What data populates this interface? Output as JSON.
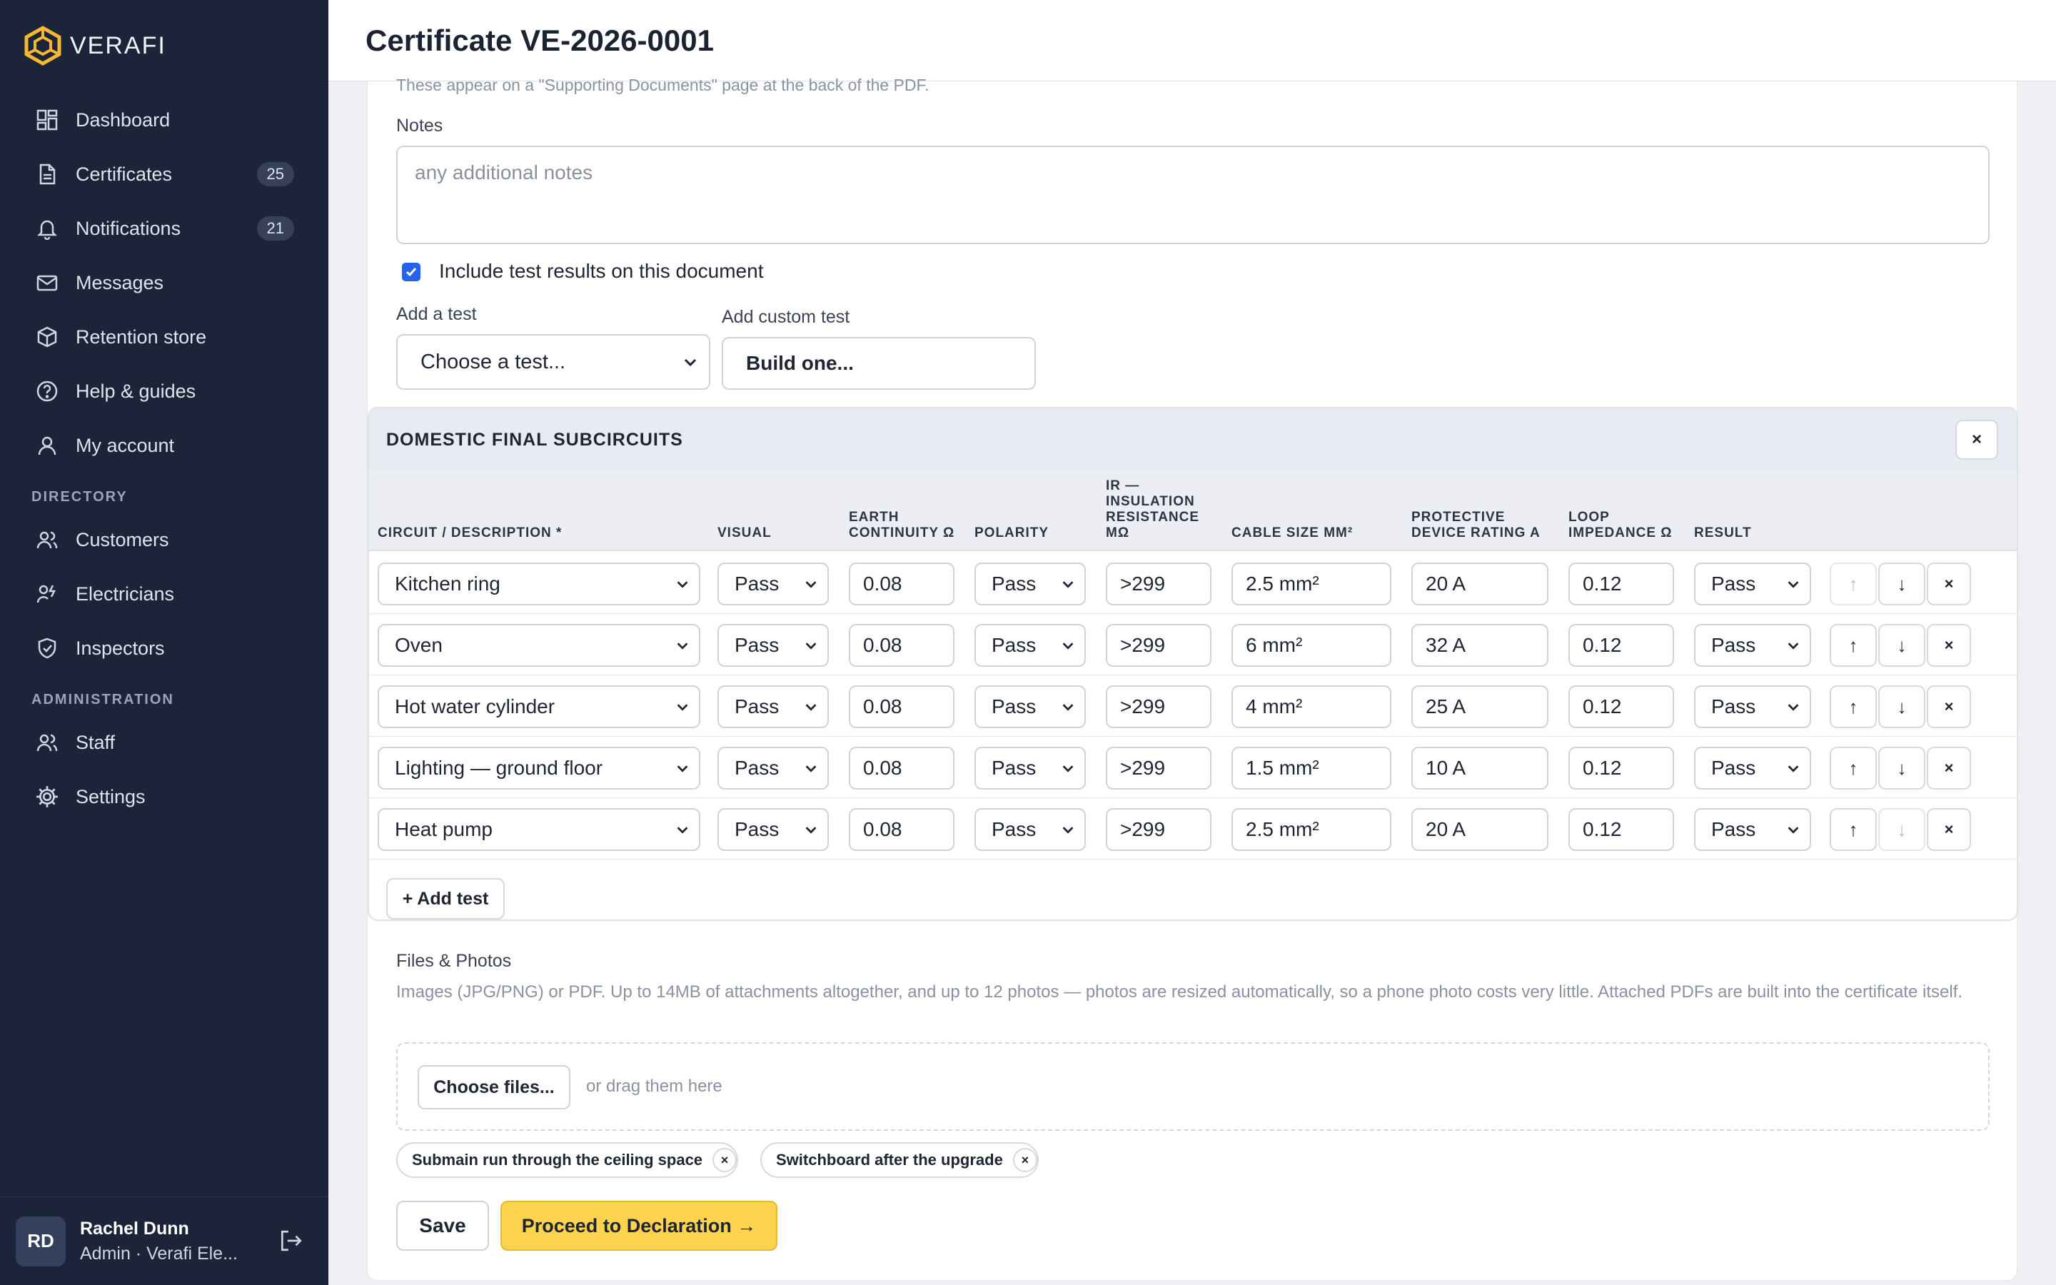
{
  "app": {
    "brand": "VERAFI"
  },
  "sidebar": {
    "items": [
      {
        "label": "Dashboard",
        "icon": "dashboard-icon"
      },
      {
        "label": "Certificates",
        "icon": "document-icon",
        "badge": "25"
      },
      {
        "label": "Notifications",
        "icon": "bell-icon",
        "badge": "21"
      },
      {
        "label": "Messages",
        "icon": "mail-icon"
      },
      {
        "label": "Retention store",
        "icon": "box-icon"
      },
      {
        "label": "Help & guides",
        "icon": "help-icon"
      },
      {
        "label": "My account",
        "icon": "user-icon"
      }
    ],
    "directory_label": "DIRECTORY",
    "directory": [
      {
        "label": "Customers",
        "icon": "users-icon"
      },
      {
        "label": "Electricians",
        "icon": "electrician-icon"
      },
      {
        "label": "Inspectors",
        "icon": "shield-icon"
      }
    ],
    "admin_label": "ADMINISTRATION",
    "admin": [
      {
        "label": "Staff",
        "icon": "staff-icon"
      },
      {
        "label": "Settings",
        "icon": "gear-icon"
      }
    ],
    "user": {
      "initials": "RD",
      "name": "Rachel Dunn",
      "role": "Admin · Verafi Ele..."
    }
  },
  "header": {
    "title": "Certificate VE-2026-0001"
  },
  "form": {
    "supporting_note": "These appear on a \"Supporting Documents\" page at the back of the PDF.",
    "notes_label": "Notes",
    "notes_placeholder": "any additional notes",
    "include_tests_label": "Include test results on this document",
    "include_tests_checked": true,
    "add_test_label": "Add a test",
    "add_test_select": "Choose a test...",
    "custom_test_label": "Add custom test",
    "custom_test_button": "Build one..."
  },
  "tests": {
    "title": "DOMESTIC FINAL SUBCIRCUITS",
    "close": "×",
    "columns": [
      [
        "CIRCUIT / DESCRIPTION *"
      ],
      [
        "VISUAL"
      ],
      [
        "EARTH",
        "CONTINUITY Ω"
      ],
      [
        "POLARITY"
      ],
      [
        "IR —",
        "INSULATION",
        "RESISTANCE",
        "MΩ"
      ],
      [
        "CABLE SIZE MM²"
      ],
      [
        "PROTECTIVE",
        "DEVICE RATING A"
      ],
      [
        "LOOP",
        "IMPEDANCE Ω"
      ],
      [
        "RESULT"
      ]
    ],
    "rows": [
      {
        "circuit": "Kitchen ring",
        "visual": "Pass",
        "earth": "0.08",
        "polarity": "Pass",
        "ir": ">299",
        "cable": "2.5 mm²",
        "device": "20 A",
        "loop": "0.12",
        "result": "Pass",
        "up_disabled": true,
        "down_disabled": false
      },
      {
        "circuit": "Oven",
        "visual": "Pass",
        "earth": "0.08",
        "polarity": "Pass",
        "ir": ">299",
        "cable": "6 mm²",
        "device": "32 A",
        "loop": "0.12",
        "result": "Pass",
        "up_disabled": false,
        "down_disabled": false
      },
      {
        "circuit": "Hot water cylinder",
        "visual": "Pass",
        "earth": "0.08",
        "polarity": "Pass",
        "ir": ">299",
        "cable": "4 mm²",
        "device": "25 A",
        "loop": "0.12",
        "result": "Pass",
        "up_disabled": false,
        "down_disabled": false
      },
      {
        "circuit": "Lighting — ground floor",
        "visual": "Pass",
        "earth": "0.08",
        "polarity": "Pass",
        "ir": ">299",
        "cable": "1.5 mm²",
        "device": "10 A",
        "loop": "0.12",
        "result": "Pass",
        "up_disabled": false,
        "down_disabled": false
      },
      {
        "circuit": "Heat pump",
        "visual": "Pass",
        "earth": "0.08",
        "polarity": "Pass",
        "ir": ">299",
        "cable": "2.5 mm²",
        "device": "20 A",
        "loop": "0.12",
        "result": "Pass",
        "up_disabled": false,
        "down_disabled": true
      }
    ],
    "add_test_button": "+ Add test"
  },
  "files": {
    "label": "Files & Photos",
    "help": "Images (JPG/PNG) or PDF. Up to 14MB of attachments altogether, and up to 12 photos — photos are resized automatically, so a phone photo costs very little. Attached PDFs are built into the certificate itself.",
    "choose_button": "Choose files...",
    "drag_hint": "or drag them here",
    "attachments": [
      "Submain run through the ceiling space",
      "Switchboard after the upgrade"
    ]
  },
  "actions": {
    "save": "Save",
    "proceed": "Proceed to Declaration →"
  },
  "colors": {
    "sidebar": "#1b2438",
    "accent": "#fcd34d",
    "checkbox": "#2563eb"
  }
}
